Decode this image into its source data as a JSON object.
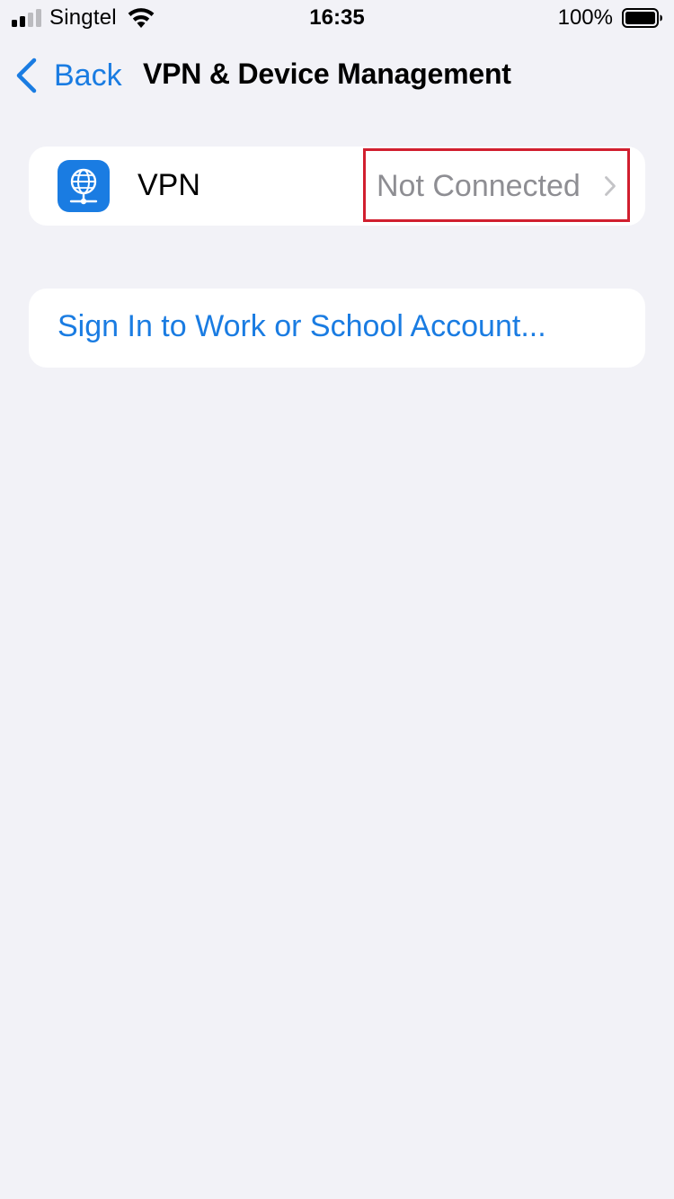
{
  "status_bar": {
    "carrier": "Singtel",
    "time": "16:35",
    "battery": "100%",
    "battery_level": 1.0
  },
  "nav": {
    "back_label": "Back",
    "title": "VPN & Device Management"
  },
  "vpn_row": {
    "label": "VPN",
    "status": "Not Connected",
    "icon": "globe-network-icon"
  },
  "signin_row": {
    "label": "Sign In to Work or School Account..."
  },
  "colors": {
    "accent": "#1a7ce2",
    "background": "#f2f2f7",
    "secondary_text": "#8e8e93",
    "highlight": "#d11f2f"
  }
}
